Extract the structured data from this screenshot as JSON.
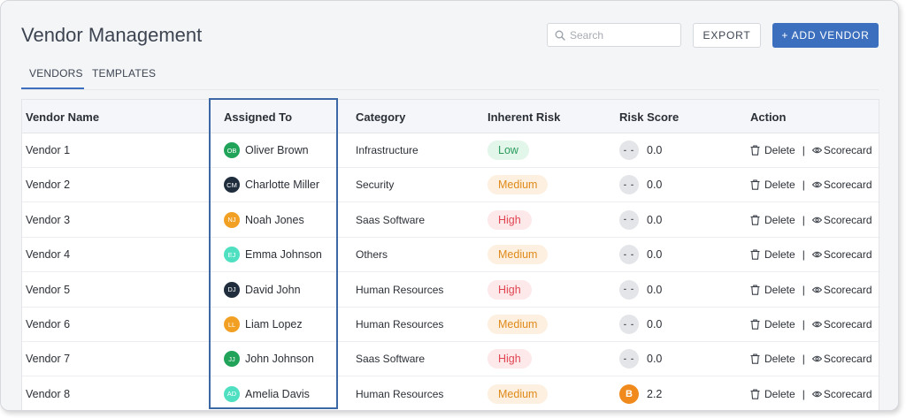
{
  "header": {
    "title": "Vendor Management",
    "search_placeholder": "Search",
    "export_label": "EXPORT",
    "add_vendor_label": "+ ADD VENDOR"
  },
  "tabs": [
    {
      "label": "VENDORS",
      "active": true
    },
    {
      "label": "TEMPLATES",
      "active": false
    }
  ],
  "table": {
    "columns": [
      "Vendor Name",
      "Assigned To",
      "Category",
      "Inherent Risk",
      "Risk Score",
      "Action"
    ],
    "action_delete_label": "Delete",
    "action_separator": "|",
    "action_scorecard_label": "Scorecard",
    "rows": [
      {
        "vendor": "Vendor 1",
        "initials": "OB",
        "assignee": "Oliver Brown",
        "avatar_color": "#21a35a",
        "category": "Infrastructure",
        "risk": "Low",
        "score_badge": "- -",
        "score": "0.0"
      },
      {
        "vendor": "Vendor 2",
        "initials": "CM",
        "assignee": "Charlotte Miller",
        "avatar_color": "#1f2d3d",
        "category": "Security",
        "risk": "Medium",
        "score_badge": "- -",
        "score": "0.0"
      },
      {
        "vendor": "Vendor 3",
        "initials": "NJ",
        "assignee": "Noah Jones",
        "avatar_color": "#f2a024",
        "category": "Saas Software",
        "risk": "High",
        "score_badge": "- -",
        "score": "0.0"
      },
      {
        "vendor": "Vendor 4",
        "initials": "EJ",
        "assignee": "Emma Johnson",
        "avatar_color": "#4fe0c2",
        "category": "Others",
        "risk": "Medium",
        "score_badge": "- -",
        "score": "0.0"
      },
      {
        "vendor": "Vendor 5",
        "initials": "DJ",
        "assignee": "David John",
        "avatar_color": "#1f2d3d",
        "category": "Human Resources",
        "risk": "High",
        "score_badge": "- -",
        "score": "0.0"
      },
      {
        "vendor": "Vendor 6",
        "initials": "LL",
        "assignee": "Liam Lopez",
        "avatar_color": "#f2a024",
        "category": "Human Resources",
        "risk": "Medium",
        "score_badge": "- -",
        "score": "0.0"
      },
      {
        "vendor": "Vendor 7",
        "initials": "JJ",
        "assignee": "John Johnson",
        "avatar_color": "#21a35a",
        "category": "Saas Software",
        "risk": "High",
        "score_badge": "- -",
        "score": "0.0"
      },
      {
        "vendor": "Vendor 8",
        "initials": "AD",
        "assignee": "Amelia Davis",
        "avatar_color": "#4fe0c2",
        "category": "Human Resources",
        "risk": "Medium",
        "score_badge": "B",
        "score": "2.2"
      }
    ]
  },
  "colors": {
    "accent": "#3c6fbd",
    "highlight_border": "#3c69a6",
    "risk_low_bg": "#e2f6ea",
    "risk_low_text": "#2a9a5b",
    "risk_medium_bg": "#fdf0e0",
    "risk_medium_text": "#e08a1a",
    "risk_high_bg": "#fde8ea",
    "risk_high_text": "#e04652",
    "score_empty_bg": "#e4e5e8",
    "score_empty_text": "#555a63",
    "score_b_bg": "#f08a1c",
    "score_b_text": "#ffffff"
  },
  "icons": {
    "search": "search-icon",
    "delete": "trash-icon",
    "scorecard": "eye-icon"
  }
}
